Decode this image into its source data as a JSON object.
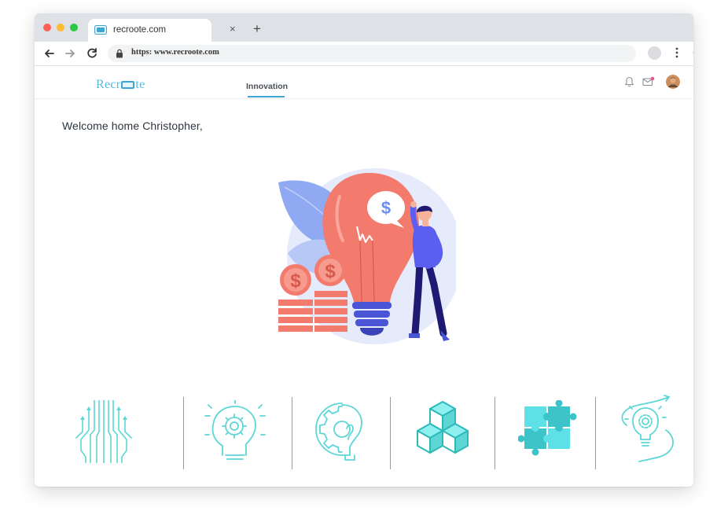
{
  "browser": {
    "tab_title": "recroote.com",
    "tab_close": "×",
    "new_tab": "+",
    "url": "https: www.recroote.com",
    "star": "☆"
  },
  "app": {
    "logo_left": "Recr",
    "logo_right": "te",
    "nav_tab": "Innovation",
    "accent_color": "#3ea6d4"
  },
  "main": {
    "welcome": "Welcome home Christopher,"
  },
  "illustration": {
    "coin_symbol": "$",
    "bubble_symbol": "$"
  },
  "icons": [
    "circuit-icon",
    "gear-head-idea-icon",
    "gear-bulb-icon",
    "cubes-icon",
    "puzzle-icon",
    "bulb-path-icon"
  ]
}
